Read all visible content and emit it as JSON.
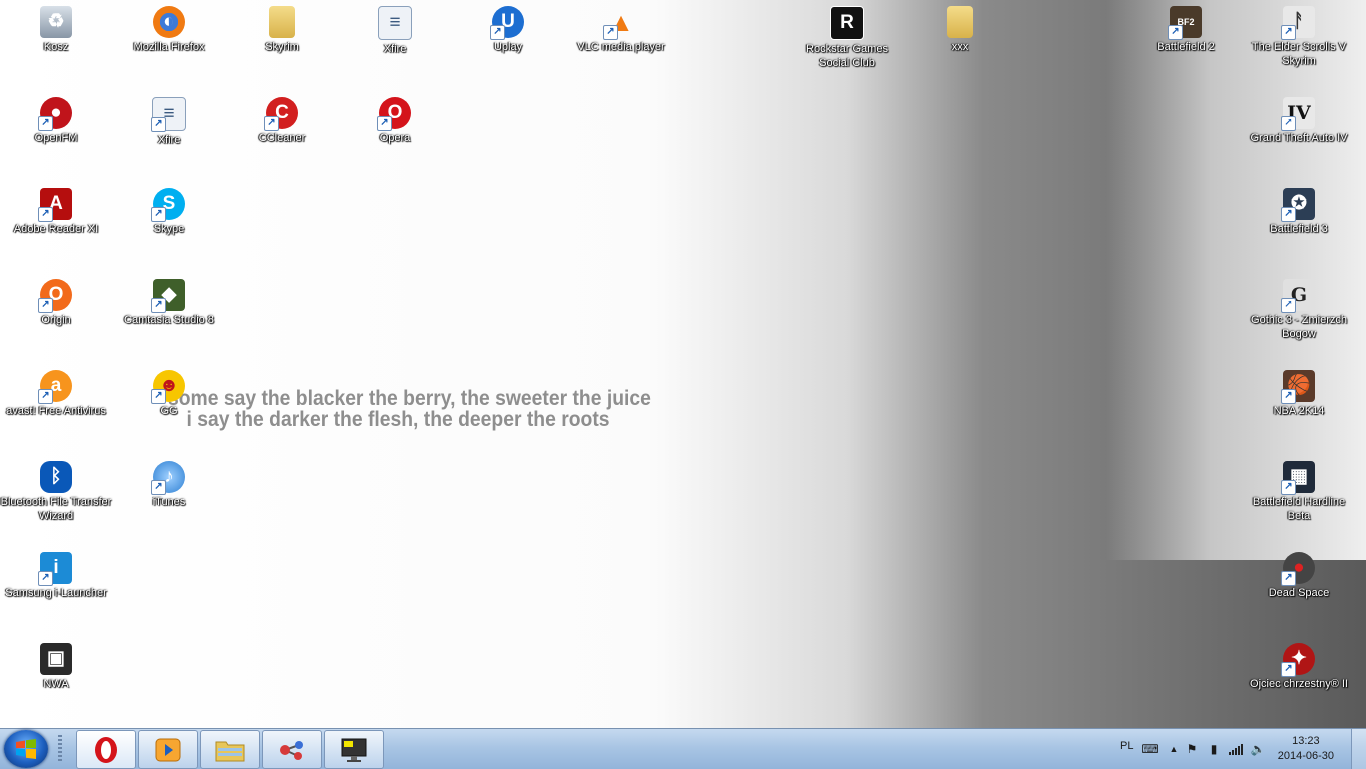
{
  "wallpaper": {
    "quote_line1": "some say the blacker the berry, the sweeter the juice",
    "quote_line2": "i say the darker the flesh, the deeper the roots"
  },
  "desktop_icons": [
    {
      "label": "Kosz",
      "icon": "recycle-bin-icon"
    },
    {
      "label": "Mozilla Firefox",
      "icon": "firefox-icon"
    },
    {
      "label": "Skyrim",
      "icon": "folder-icon"
    },
    {
      "label": "Xfire",
      "icon": "document-icon"
    },
    {
      "label": "Uplay",
      "icon": "uplay-icon"
    },
    {
      "label": "VLC media player",
      "icon": "vlc-cone-icon"
    },
    {
      "label": "Rockstar Games Social Club",
      "icon": "rockstar-icon"
    },
    {
      "label": "xxx",
      "icon": "folder-icon"
    },
    {
      "label": "Battlefield 2",
      "icon": "battlefield-icon"
    },
    {
      "label": "The Elder Scrolls V Skyrim",
      "icon": "skyrim-icon"
    },
    {
      "label": "OpenFM",
      "icon": "openfm-icon"
    },
    {
      "label": "Xfire",
      "icon": "document-icon"
    },
    {
      "label": "CCleaner",
      "icon": "ccleaner-icon"
    },
    {
      "label": "Opera",
      "icon": "opera-icon"
    },
    {
      "label": "Grand Theft Auto IV",
      "icon": "gta-icon"
    },
    {
      "label": "Adobe Reader XI",
      "icon": "adobe-reader-icon"
    },
    {
      "label": "Skype",
      "icon": "skype-icon"
    },
    {
      "label": "Battlefield 3",
      "icon": "battlefield-icon"
    },
    {
      "label": "Origin",
      "icon": "origin-icon"
    },
    {
      "label": "Camtasia Studio 8",
      "icon": "camtasia-icon"
    },
    {
      "label": "Gothic 3 - Zmierzch Bogow",
      "icon": "gothic-icon"
    },
    {
      "label": "avast! Free Antivirus",
      "icon": "avast-icon"
    },
    {
      "label": "GG",
      "icon": "gadu-gadu-icon"
    },
    {
      "label": "NBA 2K14",
      "icon": "nba-icon"
    },
    {
      "label": "Bluetooth File Transfer Wizard",
      "icon": "bluetooth-icon"
    },
    {
      "label": "iTunes",
      "icon": "itunes-icon"
    },
    {
      "label": "Battlefield Hardline Beta",
      "icon": "battlefield-hardline-icon"
    },
    {
      "label": "Samsung i-Launcher",
      "icon": "samsung-launcher-icon"
    },
    {
      "label": "Dead Space",
      "icon": "dead-space-icon"
    },
    {
      "label": "NWA",
      "icon": "image-icon"
    },
    {
      "label": "Ojciec chrzestny® II",
      "icon": "godfather-icon"
    }
  ],
  "taskbar": {
    "pinned": [
      {
        "name": "opera",
        "icon": "opera-icon"
      },
      {
        "name": "media-player",
        "icon": "media-player-icon"
      },
      {
        "name": "explorer",
        "icon": "folder-icon"
      },
      {
        "name": "app",
        "icon": "molecule-icon"
      },
      {
        "name": "monitor",
        "icon": "monitor-icon"
      }
    ],
    "tray": {
      "language": "PL",
      "time": "13:23",
      "date": "2014-06-30"
    }
  }
}
